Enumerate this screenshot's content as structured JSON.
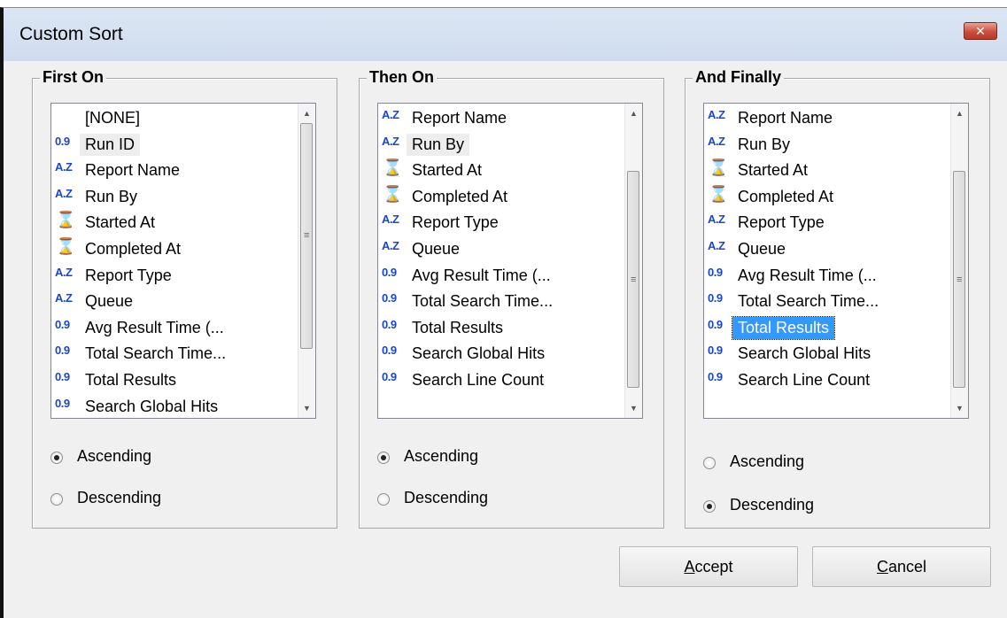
{
  "window": {
    "title": "Custom Sort",
    "close_glyph": "✕"
  },
  "icons": {
    "numeric": "0.9",
    "alpha": "A.Z",
    "time": "⌛"
  },
  "groups": [
    {
      "title": "First On",
      "items": [
        {
          "icon": "none",
          "label": "[NONE]"
        },
        {
          "icon": "numeric",
          "label": "Run ID"
        },
        {
          "icon": "alpha",
          "label": "Report Name"
        },
        {
          "icon": "alpha",
          "label": "Run By"
        },
        {
          "icon": "time",
          "label": "Started At"
        },
        {
          "icon": "time",
          "label": "Completed At"
        },
        {
          "icon": "alpha",
          "label": "Report Type"
        },
        {
          "icon": "alpha",
          "label": "Queue"
        },
        {
          "icon": "numeric",
          "label": "Avg Result Time (..."
        },
        {
          "icon": "numeric",
          "label": "Total Search Time..."
        },
        {
          "icon": "numeric",
          "label": "Total Results"
        },
        {
          "icon": "numeric",
          "label": "Search Global Hits"
        }
      ],
      "highlighted_index": 1,
      "selected_index": -1,
      "scroll_position": 0,
      "order": "Ascending",
      "ascending_label": "Ascending",
      "descending_label": "Descending"
    },
    {
      "title": "Then On",
      "items": [
        {
          "icon": "alpha",
          "label": "Report Name"
        },
        {
          "icon": "alpha",
          "label": "Run By"
        },
        {
          "icon": "time",
          "label": "Started At"
        },
        {
          "icon": "time",
          "label": "Completed At"
        },
        {
          "icon": "alpha",
          "label": "Report Type"
        },
        {
          "icon": "alpha",
          "label": "Queue"
        },
        {
          "icon": "numeric",
          "label": "Avg Result Time (..."
        },
        {
          "icon": "numeric",
          "label": "Total Search Time..."
        },
        {
          "icon": "numeric",
          "label": "Total Results"
        },
        {
          "icon": "numeric",
          "label": "Search Global Hits"
        },
        {
          "icon": "numeric",
          "label": "Search Line Count"
        }
      ],
      "highlighted_index": 1,
      "selected_index": -1,
      "scroll_position": 1,
      "order": "Ascending",
      "ascending_label": "Ascending",
      "descending_label": "Descending"
    },
    {
      "title": "And Finally",
      "items": [
        {
          "icon": "alpha",
          "label": "Report Name"
        },
        {
          "icon": "alpha",
          "label": "Run By"
        },
        {
          "icon": "time",
          "label": "Started At"
        },
        {
          "icon": "time",
          "label": "Completed At"
        },
        {
          "icon": "alpha",
          "label": "Report Type"
        },
        {
          "icon": "alpha",
          "label": "Queue"
        },
        {
          "icon": "numeric",
          "label": "Avg Result Time (..."
        },
        {
          "icon": "numeric",
          "label": "Total Search Time..."
        },
        {
          "icon": "numeric",
          "label": "Total Results"
        },
        {
          "icon": "numeric",
          "label": "Search Global Hits"
        },
        {
          "icon": "numeric",
          "label": "Search Line Count"
        }
      ],
      "highlighted_index": -1,
      "selected_index": 8,
      "scroll_position": 1,
      "order": "Descending",
      "ascending_label": "Ascending",
      "descending_label": "Descending"
    }
  ],
  "buttons": {
    "accept_label": "Accept",
    "cancel_label": "Cancel"
  },
  "colors": {
    "selection": "#3399ff",
    "icon_blue": "#1a46c8",
    "close_red": "#c9503e"
  }
}
